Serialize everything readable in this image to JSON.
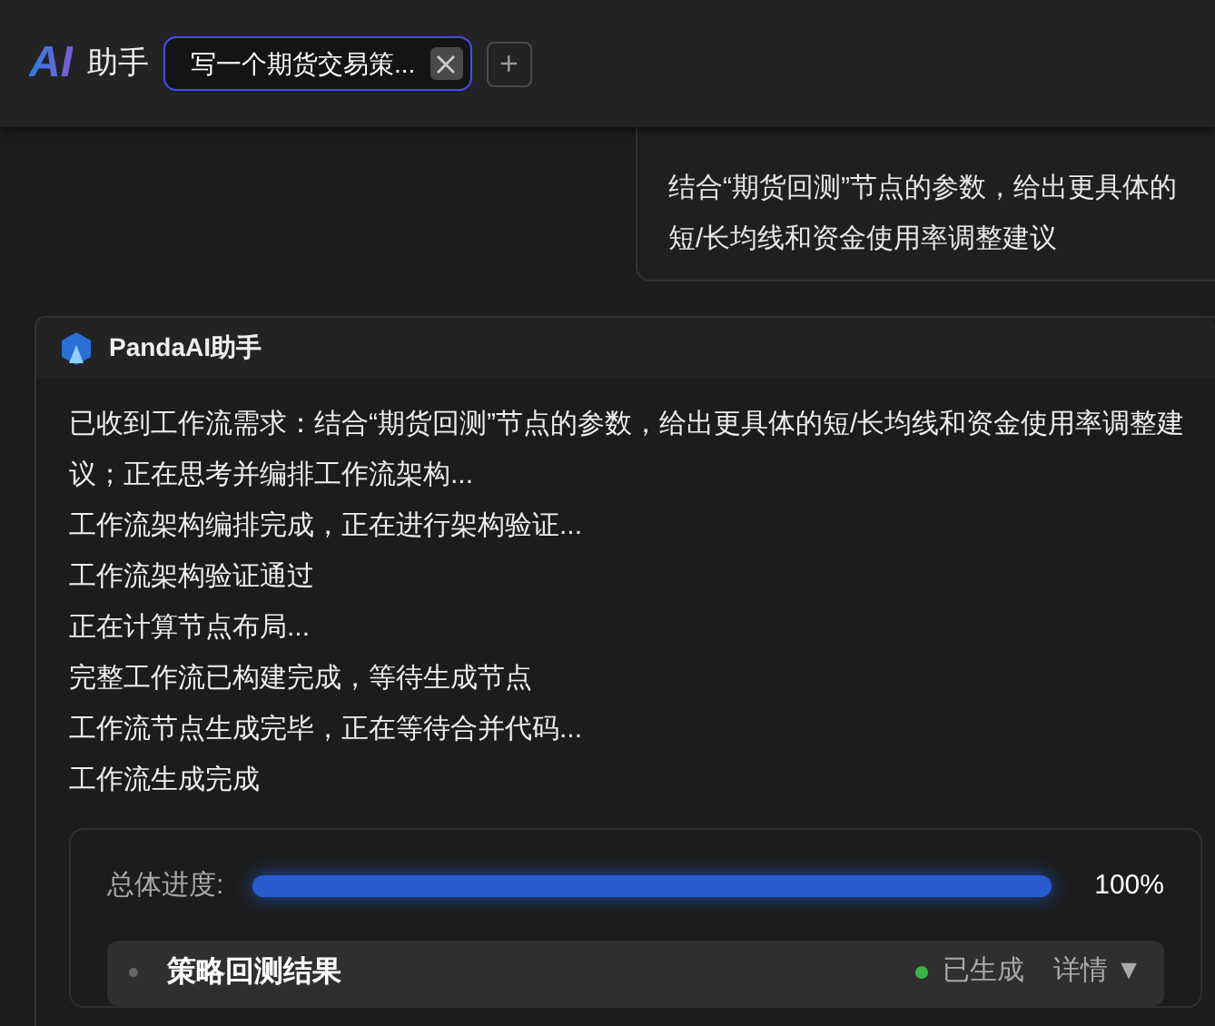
{
  "header": {
    "logo": "AI",
    "title": "助手",
    "tabs": [
      {
        "label": "写一个期货交易策...",
        "selected": true
      }
    ],
    "add_tab": "+"
  },
  "user_message": {
    "text": "结合“期货回测”节点的参数，给出更具体的短/长均线和资金使用率调整建议"
  },
  "assistant_message": {
    "sender": "PandaAI助手",
    "lines": [
      "已收到工作流需求：结合“期货回测”节点的参数，给出更具体的短/长均线和资金使用率调整建议；正在思考并编排工作流架构...",
      "工作流架构编排完成，正在进行架构验证...",
      "工作流架构验证通过",
      "正在计算节点布局...",
      "完整工作流已构建完成，等待生成节点",
      "工作流节点生成完毕，正在等待合并代码...",
      "工作流生成完成"
    ],
    "progress": {
      "label": "总体进度:",
      "level": 1,
      "reading": "100%"
    },
    "results": [
      {
        "title": "策略回测结果",
        "status": "已生成",
        "color": "#3cb44b",
        "details": "详情 ▼",
        "expanded": false
      }
    ]
  }
}
